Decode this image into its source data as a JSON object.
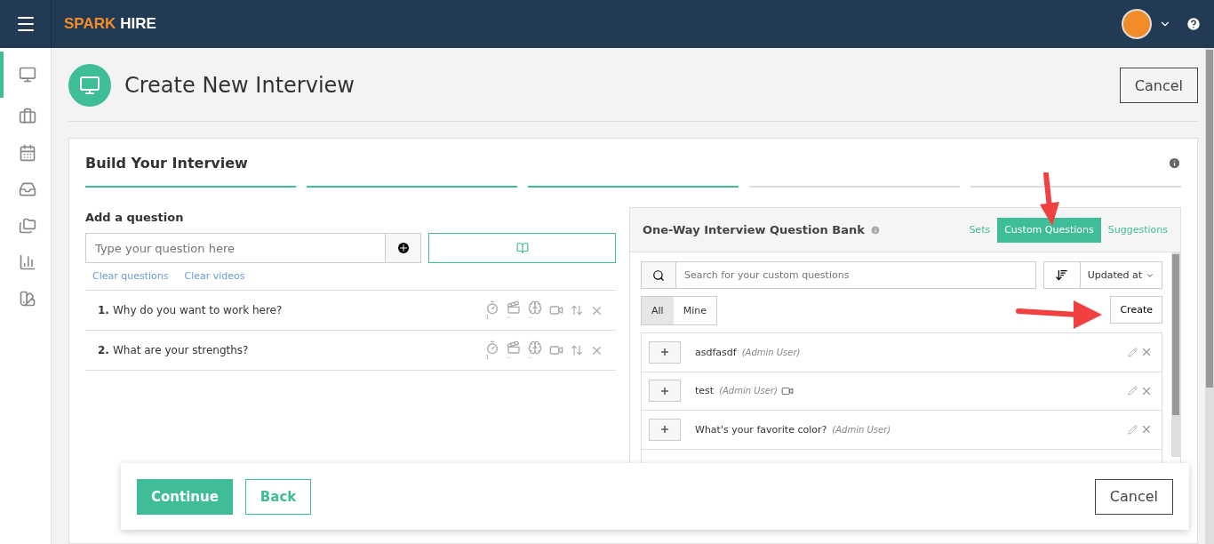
{
  "topbar": {
    "logo_primary": "SPARK",
    "logo_secondary": "HIRE"
  },
  "sidebar": {
    "items": [
      {
        "selected": true
      },
      {
        "selected": false
      },
      {
        "selected": false
      },
      {
        "selected": false
      },
      {
        "selected": false
      },
      {
        "selected": false
      },
      {
        "selected": false
      }
    ]
  },
  "header": {
    "title": "Create New Interview",
    "cancel": "Cancel"
  },
  "builder": {
    "title": "Build Your Interview",
    "steps": [
      {
        "done": true
      },
      {
        "done": true
      },
      {
        "done": true
      },
      {
        "done": false
      },
      {
        "done": false
      }
    ],
    "add_label": "Add a question",
    "input": {
      "placeholder": "Type your question here"
    },
    "links": [
      "Clear questions",
      "Clear videos"
    ],
    "questions": [
      {
        "number": "1.",
        "text": "Why do you want to work here?",
        "limits": [
          "1",
          "--",
          "--"
        ]
      },
      {
        "number": "2.",
        "text": "What are your strengths?",
        "limits": [
          "1",
          "--",
          "--"
        ]
      }
    ]
  },
  "bank": {
    "title": "One-Way Interview Question Bank",
    "tabs": [
      {
        "label": "Sets",
        "selected": false
      },
      {
        "label": "Custom Questions",
        "selected": true
      },
      {
        "label": "Suggestions",
        "selected": false
      }
    ],
    "search": {
      "placeholder": "Search for your custom questions"
    },
    "sort": "Updated at",
    "filters": [
      {
        "label": "All",
        "selected": true
      },
      {
        "label": "Mine",
        "selected": false
      }
    ],
    "create": "Create",
    "items": [
      {
        "text": "asdfasdf",
        "author": "(Admin User)",
        "video": false
      },
      {
        "text": "test",
        "author": "(Admin User)",
        "video": true
      },
      {
        "text": "What's your favorite color?",
        "author": "(Admin User)",
        "video": false
      }
    ]
  },
  "footer": {
    "continue": "Continue",
    "back": "Back",
    "cancel": "Cancel"
  }
}
